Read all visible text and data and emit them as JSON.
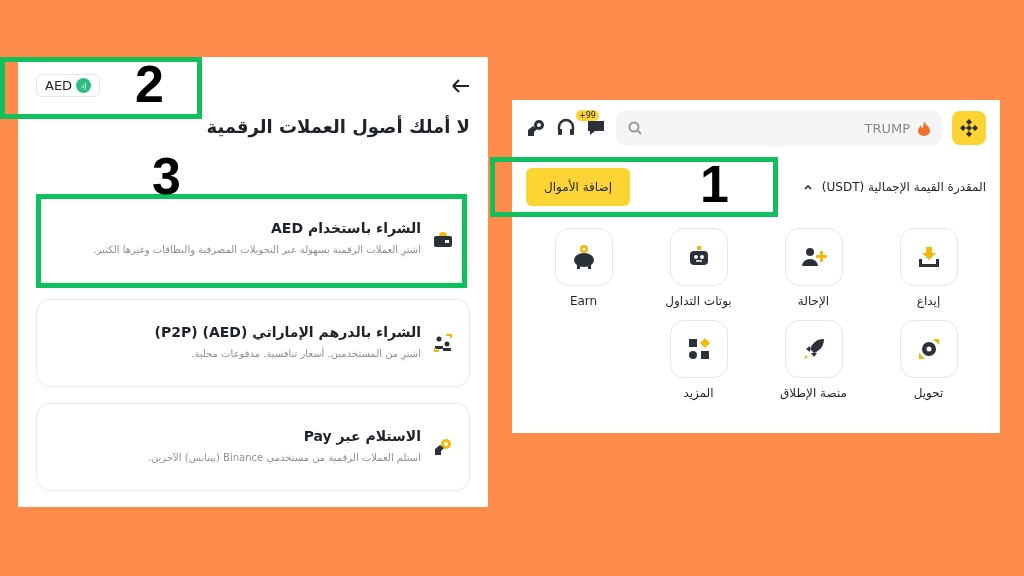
{
  "buy_screen": {
    "currency_chip": {
      "label": "AED",
      "badge": "إد"
    },
    "title": "لا أملك أصول العملات الرقمية",
    "options": [
      {
        "title": "الشراء باستخدام AED",
        "description": "اشترِ العملات الرقمية بسهولة عبر التحويلات المصرفية والبطاقات وغيرها الكثير."
      },
      {
        "title": "الشراء بالدرهم الإماراتي (AED) (P2P)",
        "description": "اشترِ من المستخدمين. أسعار تنافسية. مدفوعات محلية."
      },
      {
        "title": "الاستلام عبر Pay",
        "description": "استلم العملات الرقمية من مستخدمي Binance (بينانس) الآخرين."
      }
    ]
  },
  "home_screen": {
    "search": {
      "placeholder": "TRUMP"
    },
    "messages_badge": "+99",
    "balance_label": "المقدرة القيمة الإجمالية (USDT)",
    "add_funds_button": "إضافة الأموال",
    "shortcuts": [
      {
        "label": "إيداع"
      },
      {
        "label": "الإحالة"
      },
      {
        "label": "بوتات التداول"
      },
      {
        "label": "Earn"
      },
      {
        "label": "تحويل"
      },
      {
        "label": "منصة الإطلاق"
      },
      {
        "label": "المزيد"
      }
    ]
  },
  "annotations": [
    {
      "number": "1"
    },
    {
      "number": "2"
    },
    {
      "number": "3"
    }
  ]
}
